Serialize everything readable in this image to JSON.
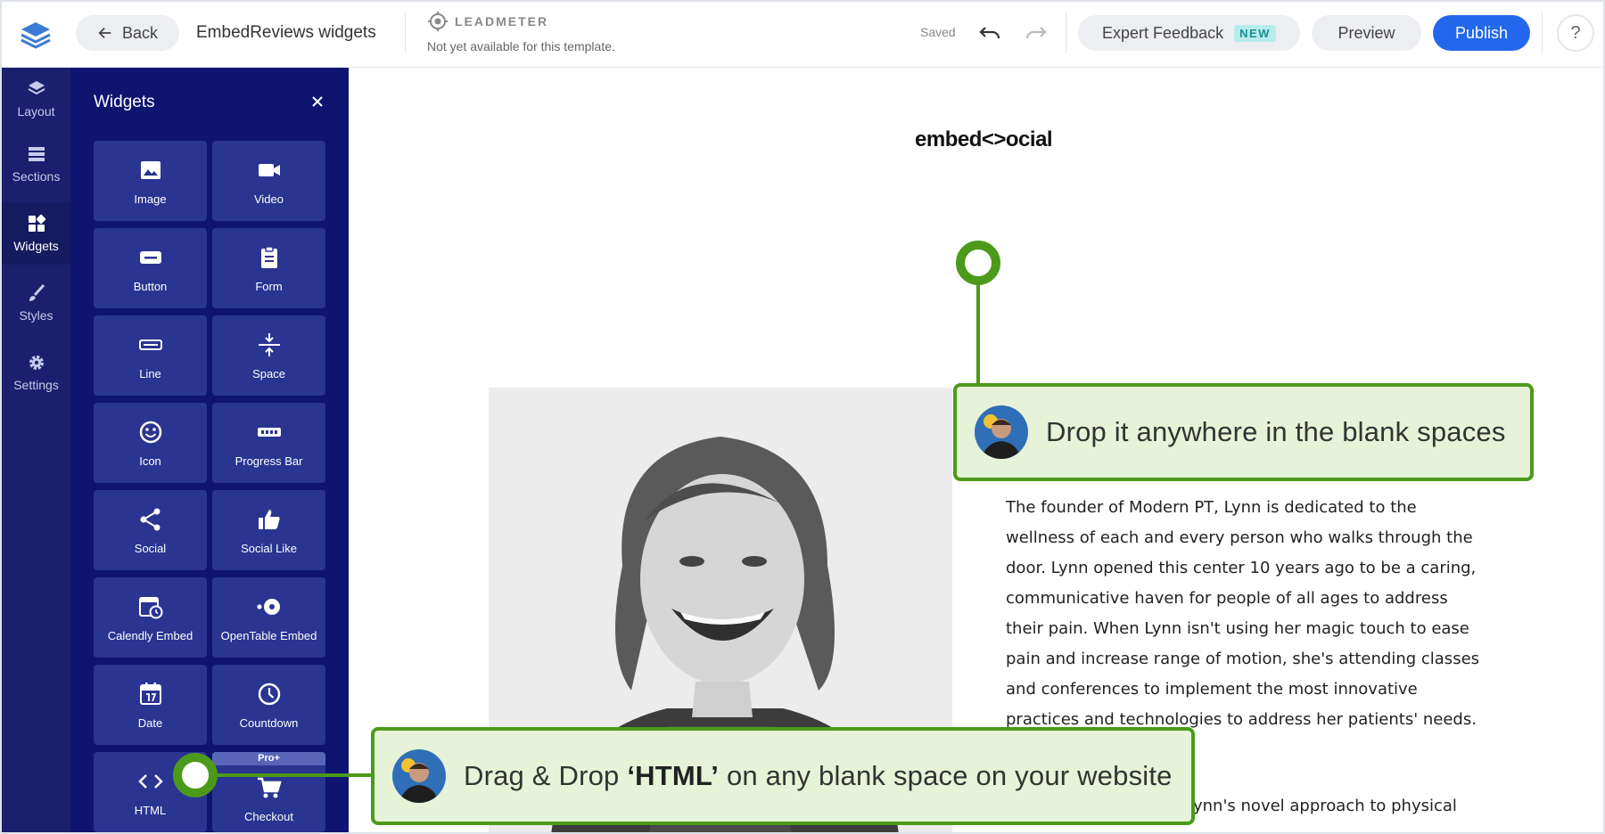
{
  "topbar": {
    "back_label": "Back",
    "doc_title": "EmbedReviews widgets",
    "leadmeter_title": "LEADMETER",
    "leadmeter_subtitle": "Not yet available for this template.",
    "saved_label": "Saved",
    "expert_label": "Expert Feedback",
    "new_badge": "NEW",
    "preview_label": "Preview",
    "publish_label": "Publish",
    "help_label": "?"
  },
  "rail": {
    "items": [
      {
        "label": "Layout",
        "icon": "layers-icon"
      },
      {
        "label": "Sections",
        "icon": "sections-icon"
      },
      {
        "label": "Widgets",
        "icon": "widgets-icon",
        "active": true
      },
      {
        "label": "Styles",
        "icon": "brush-icon"
      },
      {
        "label": "Settings",
        "icon": "gear-icon"
      }
    ]
  },
  "panel": {
    "title": "Widgets",
    "close_icon": "close-icon",
    "tiles": [
      {
        "label": "Image",
        "icon": "image-icon"
      },
      {
        "label": "Video",
        "icon": "video-icon"
      },
      {
        "label": "Button",
        "icon": "button-icon"
      },
      {
        "label": "Form",
        "icon": "form-icon"
      },
      {
        "label": "Line",
        "icon": "line-icon"
      },
      {
        "label": "Space",
        "icon": "space-icon"
      },
      {
        "label": "Icon",
        "icon": "smiley-icon"
      },
      {
        "label": "Progress Bar",
        "icon": "progress-bar-icon"
      },
      {
        "label": "Social",
        "icon": "share-icon"
      },
      {
        "label": "Social Like",
        "icon": "thumbs-up-icon"
      },
      {
        "label": "Calendly Embed",
        "icon": "calendar-clock-icon"
      },
      {
        "label": "OpenTable Embed",
        "icon": "opentable-icon"
      },
      {
        "label": "Date",
        "icon": "date-icon"
      },
      {
        "label": "Countdown",
        "icon": "clock-icon"
      },
      {
        "label": "HTML",
        "icon": "code-icon"
      },
      {
        "label": "Checkout",
        "icon": "cart-icon",
        "tag": "Pro+"
      }
    ]
  },
  "canvas": {
    "brand": "embed<>ocial",
    "bio_lines": [
      "The founder of Modern PT, Lynn is dedicated to the",
      "wellness of each and every person who walks through the",
      "door. Lynn opened this center 10 years ago to be a caring,",
      "communicative haven for people of all ages to address",
      "their pain. When Lynn isn't using her magic touch to ease",
      "pain and increase range of motion, she's attending classes",
      "and conferences to implement the most innovative",
      "practices and technologies to address her patients' needs."
    ],
    "bio_line_2": "ynn's novel approach to physical"
  },
  "callouts": {
    "top": "Drop it anywhere in the blank spaces",
    "bottom_prefix": "Drag & Drop ",
    "bottom_bold": "‘HTML’",
    "bottom_suffix": " on any blank space on your website"
  },
  "colors": {
    "publish": "#2368ec",
    "rail": "#1b1f6e",
    "panel": "#0f1470",
    "tile": "#2a3491",
    "callout_border": "#4c9a1a",
    "callout_bg": "#e6f3d8"
  }
}
